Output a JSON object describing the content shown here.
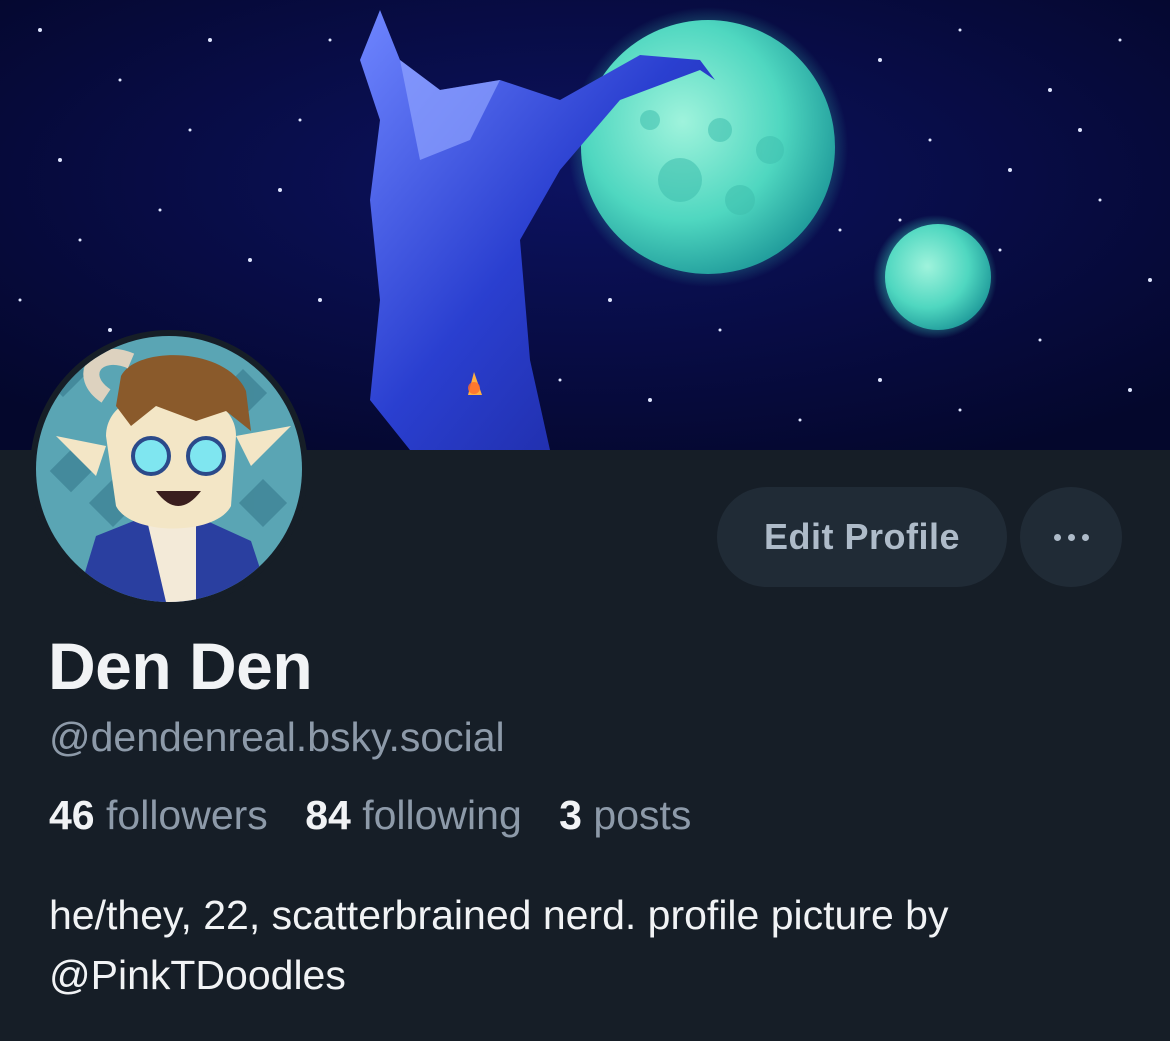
{
  "profile": {
    "display_name": "Den Den",
    "handle": "@dendenreal.bsky.social",
    "followers_count": "46",
    "followers_label": "followers",
    "following_count": "84",
    "following_label": "following",
    "posts_count": "3",
    "posts_label": "posts",
    "bio_line1": "he/they, 22, scatterbrained nerd. profile picture by",
    "bio_line2": "@PinkTDoodles"
  },
  "actions": {
    "edit_profile_label": "Edit Profile",
    "more_icon": "ellipsis-icon"
  },
  "colors": {
    "background": "#161e27",
    "button_bg": "#202b36",
    "muted_text": "#8d9aa9",
    "primary_text": "#f1f3f5"
  }
}
